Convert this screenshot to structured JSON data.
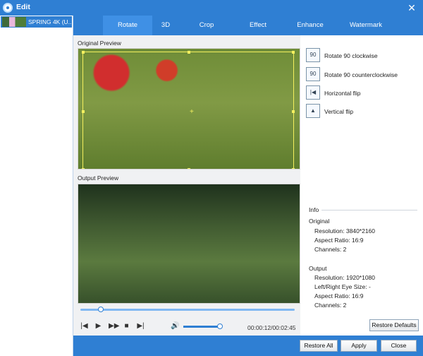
{
  "window": {
    "title": "Edit",
    "close_symbol": "✕"
  },
  "sidebar": {
    "file_name": "SPRING 4K (U..."
  },
  "tabs": [
    "Rotate",
    "3D",
    "Crop",
    "Effect",
    "Enhance",
    "Watermark"
  ],
  "preview": {
    "original_label": "Original Preview",
    "output_label": "Output Preview"
  },
  "actions": [
    {
      "label": "Rotate 90 clockwise",
      "icon": "rotate-clockwise-icon",
      "symbol": "90"
    },
    {
      "label": "Rotate 90 counterclockwise",
      "icon": "rotate-counterclockwise-icon",
      "symbol": "90"
    },
    {
      "label": "Horizontal flip",
      "icon": "horizontal-flip-icon",
      "symbol": "|◀"
    },
    {
      "label": "Vertical flip",
      "icon": "vertical-flip-icon",
      "symbol": "▲"
    }
  ],
  "info": {
    "title": "Info",
    "original_title": "Original",
    "original_resolution": "Resolution: 3840*2160",
    "original_aspect": "Aspect Ratio: 16:9",
    "original_channels": "Channels: 2",
    "output_title": "Output",
    "output_resolution": "Resolution: 1920*1080",
    "output_eye": "Left/Right Eye Size: -",
    "output_aspect": "Aspect Ratio: 16:9",
    "output_channels": "Channels: 2"
  },
  "player": {
    "time": "00:00:12/00:02:45",
    "progress_fraction": 0.07,
    "volume_fraction": 0.85
  },
  "buttons": {
    "restore_defaults": "Restore Defaults",
    "restore_all": "Restore All",
    "apply": "Apply",
    "close": "Close"
  },
  "colors": {
    "accent": "#2f7fd3",
    "crop_frame": "#f4f05f"
  }
}
